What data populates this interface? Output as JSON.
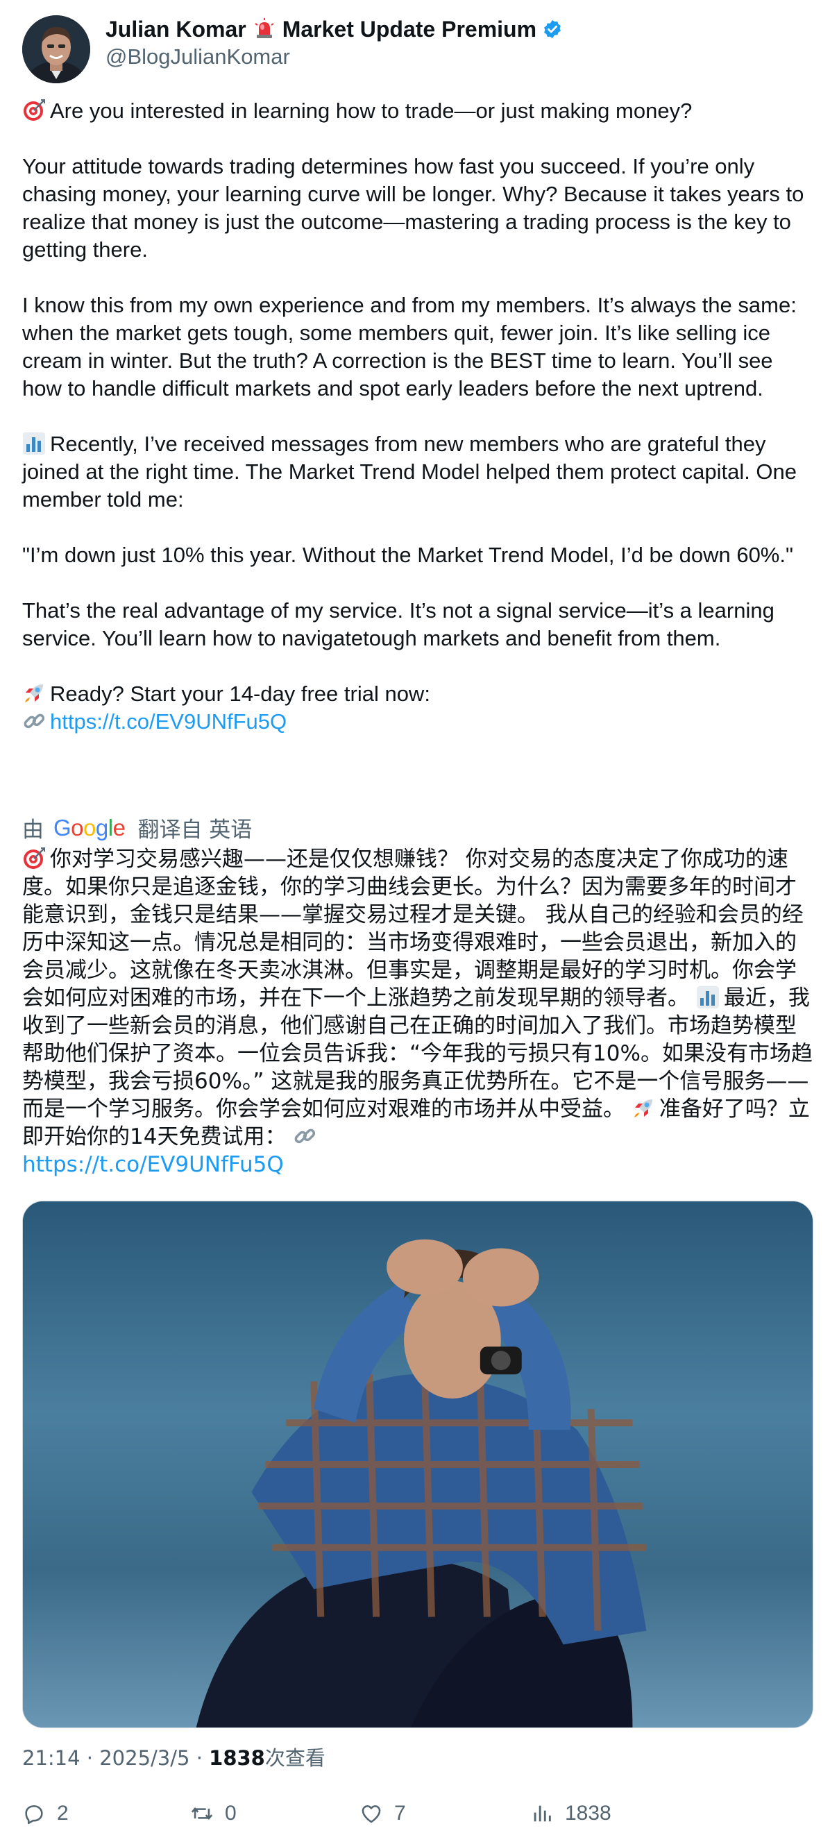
{
  "author": {
    "display_name_part1": "Julian Komar",
    "display_name_part2": "Market Update Premium",
    "handle": "@BlogJulianKomar",
    "badge_icon": "verified-icon",
    "separator_icon": "siren-icon"
  },
  "tweet": {
    "p1": "Are you interested in learning how to trade—or just making money?",
    "p2": "Your attitude towards trading determines how fast you succeed. If you’re only chasing money, your learning curve will be longer. Why? Because it takes years to realize that money is just the outcome—mastering a trading process is the key to getting there.",
    "p3": "I know this from my own experience and from my members. It’s always the same: when the market gets tough, some members quit, fewer join. It’s like selling ice cream in winter. But the truth? A correction is the BEST time to learn. You’ll see how to handle difficult markets and spot early leaders before the next uptrend.",
    "p4": "Recently, I’ve received messages from new members who are grateful they joined at the right time. The Market Trend Model helped them protect capital. One member told me:",
    "p5": "\"I’m down just 10% this year. Without the Market Trend Model, I’d be down 60%.\"",
    "p6": "That’s the real advantage of my service. It’s not a signal service—it’s a learning service. You’ll learn how to navigatetough markets and benefit from them.",
    "p7": "Ready? Start your 14-day free trial now:",
    "link": "https://t.co/EV9UNfFu5Q"
  },
  "translation": {
    "prefix": "由",
    "google_letters": [
      "G",
      "o",
      "o",
      "g",
      "l",
      "e"
    ],
    "suffix": "翻译自 英语",
    "text": "你对学习交易感兴趣——还是仅仅想赚钱？ 你对交易的态度决定了你成功的速度。如果你只是追逐金钱，你的学习曲线会更长。为什么？因为需要多年的时间才能意识到，金钱只是结果——掌握交易过程才是关键。 我从自己的经验和会员的经历中深知这一点。情况总是相同的：当市场变得艰难时，一些会员退出，新加入的会员减少。这就像在冬天卖冰淇淋。但事实是，调整期是最好的学习时机。你会学会如何应对困难的市场，并在下一个上涨趋势之前发现早期的领导者。",
    "text2": "最近，我收到了一些新会员的消息，他们感谢自己在正确的时间加入了我们。市场趋势模型帮助他们保护了资本。一位会员告诉我：“今年我的亏损只有10%。如果没有市场趋势模型，我会亏损60%。” 这就是我的服务真正优势所在。它不是一个信号服务——而是一个学习服务。你会学会如何应对艰难的市场并从中受益。",
    "text3": "准备好了吗？立即开始你的14天免费试用：",
    "link": "https://t.co/EV9UNfFu5Q"
  },
  "meta": {
    "time": "21:14 · 2025/3/5 · ",
    "views_count": "1838",
    "views_label": "次查看"
  },
  "actions": {
    "replies": "2",
    "retweets": "0",
    "likes": "7",
    "views": "1838"
  },
  "colors": {
    "link": "#1d9bf0",
    "secondary_text": "#536471",
    "verified": "#1d9bf0"
  }
}
